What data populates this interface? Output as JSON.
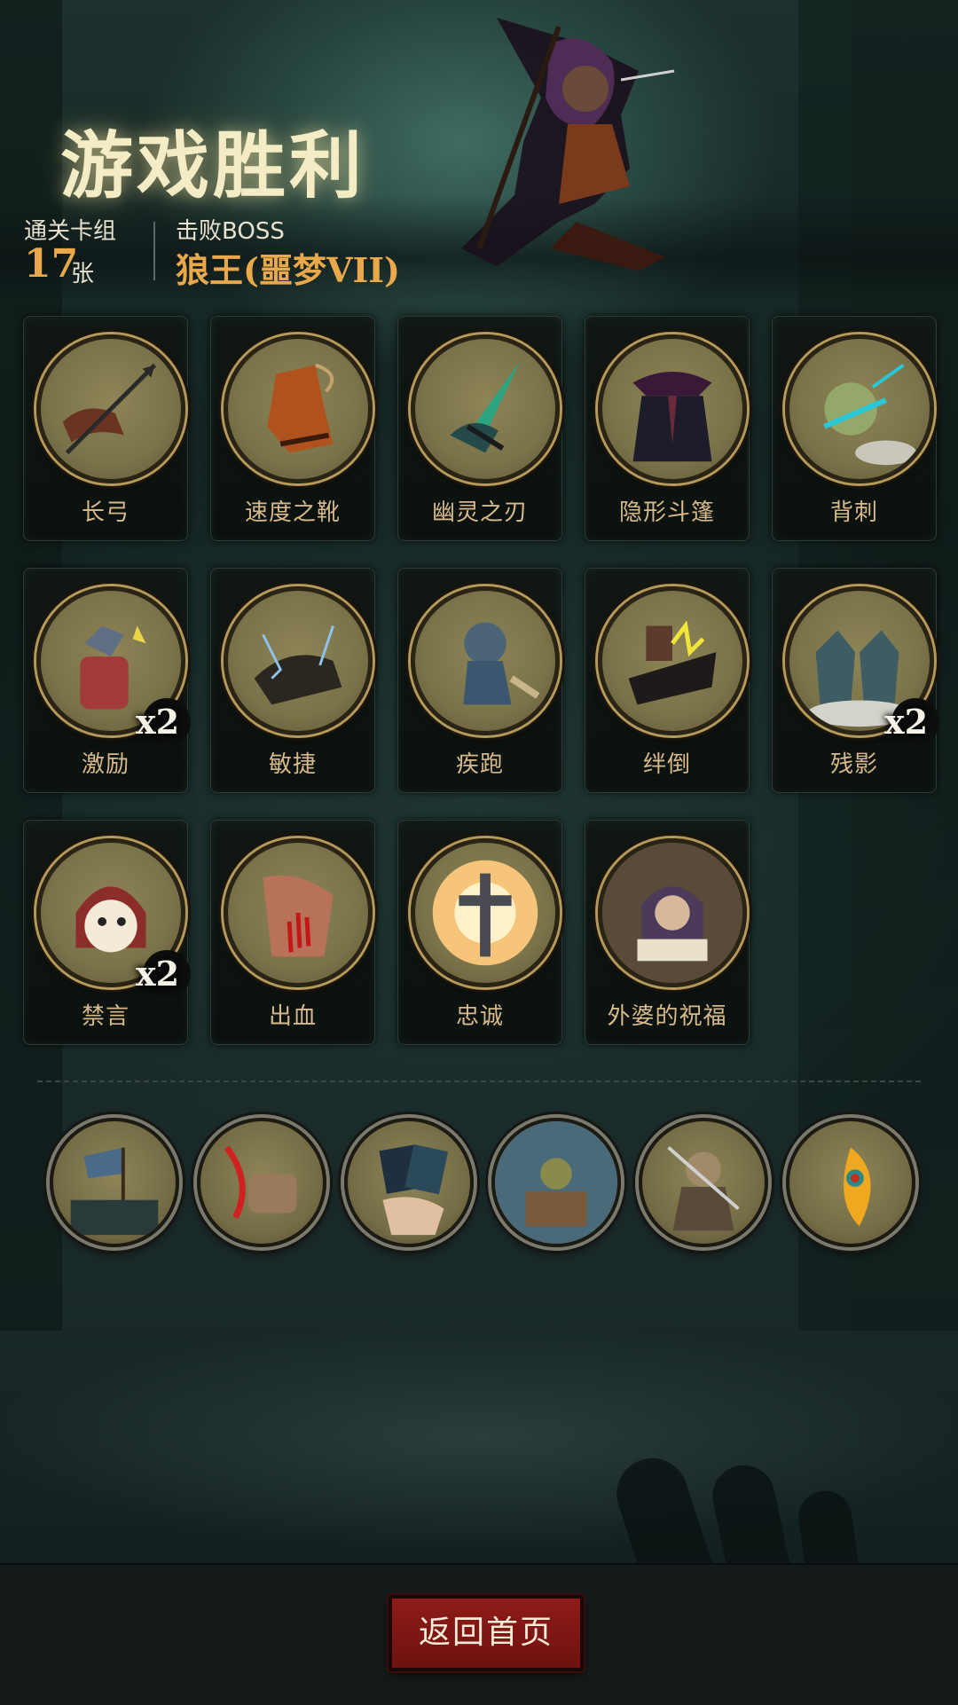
{
  "header": {
    "title": "游戏胜利",
    "deck_label": "通关卡组",
    "deck_count": "17",
    "deck_unit": "张",
    "boss_label": "击败BOSS",
    "boss_name": "狼王(噩梦VII)"
  },
  "cards": [
    {
      "label": "长弓",
      "icon": "longbow-icon",
      "count": ""
    },
    {
      "label": "速度之靴",
      "icon": "speed-boots-icon",
      "count": ""
    },
    {
      "label": "幽灵之刃",
      "icon": "ghost-blade-icon",
      "count": ""
    },
    {
      "label": "隐形斗篷",
      "icon": "invisibility-cloak-icon",
      "count": ""
    },
    {
      "label": "背刺",
      "icon": "backstab-icon",
      "count": ""
    },
    {
      "label": "激励",
      "icon": "inspire-icon",
      "count": "x2"
    },
    {
      "label": "敏捷",
      "icon": "agility-panther-icon",
      "count": ""
    },
    {
      "label": "疾跑",
      "icon": "sprint-icon",
      "count": ""
    },
    {
      "label": "绊倒",
      "icon": "trip-icon",
      "count": ""
    },
    {
      "label": "残影",
      "icon": "afterimage-icon",
      "count": "x2"
    },
    {
      "label": "禁言",
      "icon": "silence-icon",
      "count": "x2"
    },
    {
      "label": "出血",
      "icon": "bleed-icon",
      "count": ""
    },
    {
      "label": "忠诚",
      "icon": "loyalty-cross-icon",
      "count": ""
    },
    {
      "label": "外婆的祝福",
      "icon": "grandma-blessing-icon",
      "count": ""
    }
  ],
  "relics": [
    {
      "icon": "battle-banner-relic-icon"
    },
    {
      "icon": "slash-gauntlet-relic-icon"
    },
    {
      "icon": "card-hand-relic-icon"
    },
    {
      "icon": "treasure-doll-relic-icon"
    },
    {
      "icon": "warrior-relic-icon"
    },
    {
      "icon": "phoenix-feather-relic-icon"
    }
  ],
  "footer": {
    "home_button": "返回首页"
  },
  "colors": {
    "title_glow": "#f3ecc5",
    "accent_orange": "#e9a84a",
    "card_label": "#d8b98a",
    "button_red": "#8e1b18"
  }
}
